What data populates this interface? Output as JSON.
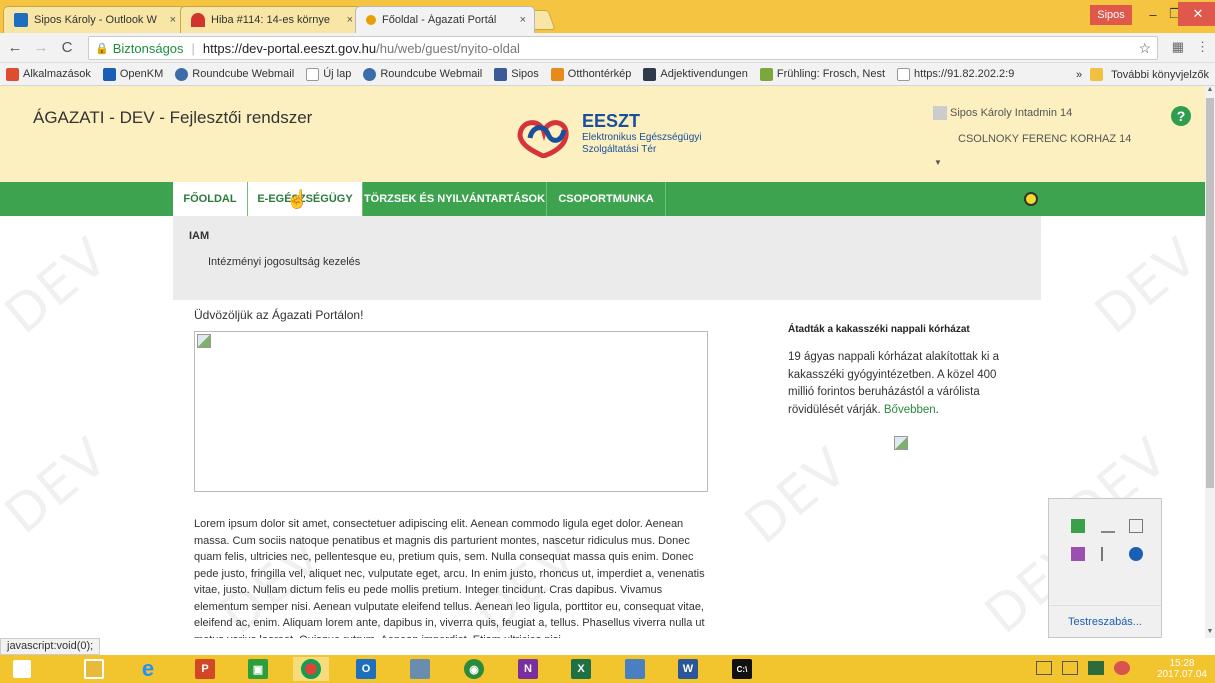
{
  "browser": {
    "tabs": [
      {
        "title": "Sipos Károly - Outlook W",
        "fav_color": "#1f6fbf"
      },
      {
        "title": "Hiba #114: 14-es környe",
        "fav_color": "#d0342c"
      },
      {
        "title": "Főoldal - Ágazati Portál",
        "fav_color": "#e8a000"
      }
    ],
    "tab_close": "×",
    "profile": "Sipos",
    "address": {
      "secure_label": "Biztonságos",
      "host": "https://dev-portal.eeszt.gov.hu",
      "path": "/hu/web/guest/nyito-oldal"
    },
    "bookmarks": [
      {
        "label": "Alkalmazások",
        "color": "#e04c2f"
      },
      {
        "label": "OpenKM",
        "color": "#1a5fb4"
      },
      {
        "label": "Roundcube Webmail",
        "color": "#3b6ea8"
      },
      {
        "label": "Új lap",
        "color": "#999999"
      },
      {
        "label": "Roundcube Webmail",
        "color": "#3b6ea8"
      },
      {
        "label": "Sipos",
        "color": "#3b5998"
      },
      {
        "label": "Otthontérkép",
        "color": "#e88a1a"
      },
      {
        "label": "Adjektivendungen",
        "color": "#2f3a4a"
      },
      {
        "label": "Frühling: Frosch, Nest",
        "color": "#7aa83b"
      },
      {
        "label": "https://91.82.202.2:9",
        "color": "#999999"
      }
    ],
    "bookmarks_more": "»",
    "other_bookmarks": "További könyvjelzők",
    "status_text": "javascript:void(0);"
  },
  "portal": {
    "site_title": "ÁGAZATI - DEV - Fejlesztői rendszer",
    "logo_name": "EESZT",
    "logo_sub1": "Elektronikus Egészségügyi",
    "logo_sub2": "Szolgáltatási Tér",
    "user_name": "Sipos Károly Intadmin 14",
    "org_name": "CSOLNOKY FERENC KORHAZ 14",
    "help": "?",
    "watermark": "DEV",
    "nav": [
      "FŐOLDAL",
      "E-EGÉSZSÉGÜGY",
      "TÖRZSEK ÉS NYILVÁNTARTÁSOK",
      "CSOPORTMUNKA"
    ],
    "dropdown_header": "IAM",
    "dropdown_item": "Intézményi jogosultság kezelés",
    "welcome": "Üdvözöljük az Ágazati Portálon!",
    "lorem": "Lorem ipsum dolor sit amet, consectetuer adipiscing elit. Aenean commodo ligula eget dolor. Aenean massa. Cum sociis natoque penatibus et magnis dis parturient montes, nascetur ridiculus mus. Donec quam felis, ultricies nec, pellentesque eu, pretium quis, sem. Nulla consequat massa quis enim. Donec pede justo, fringilla vel, aliquet nec, vulputate eget, arcu. In enim justo, rhoncus ut, imperdiet a, venenatis vitae, justo. Nullam dictum felis eu pede mollis pretium. Integer tincidunt. Cras dapibus. Vivamus elementum semper nisi. Aenean vulputate eleifend tellus. Aenean leo ligula, porttitor eu, consequat vitae, eleifend ac, enim. Aliquam lorem ante, dapibus in, viverra quis, feugiat a, tellus. Phasellus viverra nulla ut metus varius laoreet. Quisque rutrum. Aenean imperdiet. Etiam ultricies nisi",
    "news_title": "Átadták a kakasszéki nappali kórházat",
    "news_body": "19 ágyas nappali kórházat alakítottak ki a kakasszéki gyógyintézetben. A közel 400 millió forintos beruházástól a várólista rövidülését várják. ",
    "news_more": "Bővebben",
    "news_period": "."
  },
  "tray": {
    "customize": "Testreszabás..."
  },
  "clock": {
    "time": "15:28",
    "date": "2017.07.04"
  },
  "colors": {
    "accent_green": "#3ea34f",
    "header_bg": "#fcf0c0",
    "chrome_yellow": "#f5c542"
  }
}
